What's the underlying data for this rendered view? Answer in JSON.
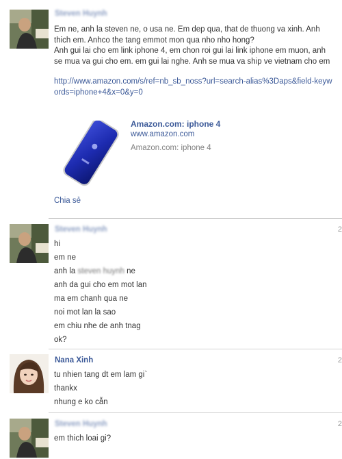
{
  "messages": [
    {
      "author": "Steven Huynh",
      "lines": [
        "Em ne, anh la steven ne, o usa ne. Em dep qua, that de thuong va xinh. Anh thich em. Anhco the tang emmot mon qua nho nho hong?",
        "Anh gui lai cho em link iphone 4, em chon roi gui lai link iphone em muon, anh se mua va gui cho em. em gui lai nghe. Anh se mua va ship ve vietnam cho em"
      ],
      "link": "http://www.amazon.com/s/ref=nb_sb_noss?url=search-alias%3Daps&field-keywords=iphone+4&x=0&y=0",
      "preview": {
        "title": "Amazon.com: iphone 4",
        "url": "www.amazon.com",
        "description": "Amazon.com: iphone 4"
      },
      "share_label": "Chia sẻ"
    },
    {
      "author": "Steven Huynh",
      "time": "2",
      "lines": [
        "hi",
        "em ne"
      ],
      "line3_prefix": "anh la ",
      "line3_blurred": "steven huynh",
      "line3_suffix": " ne",
      "lines_after": [
        "anh da gui cho em mot lan",
        "ma em chanh qua ne",
        "noi mot lan la sao",
        "em chiu nhe de anh tnag",
        "ok?"
      ]
    },
    {
      "author": "Nana Xinh",
      "time": "2",
      "lines": [
        "tu nhien tang dt em lam gi`",
        "thankx",
        "nhung e ko cẫn"
      ]
    },
    {
      "author": "Steven Huynh",
      "time": "2",
      "lines": [
        "em thich loai gi?"
      ]
    }
  ],
  "colors": {
    "link": "#3b5998",
    "separator": "#d3d3d3",
    "text": "#333333"
  }
}
